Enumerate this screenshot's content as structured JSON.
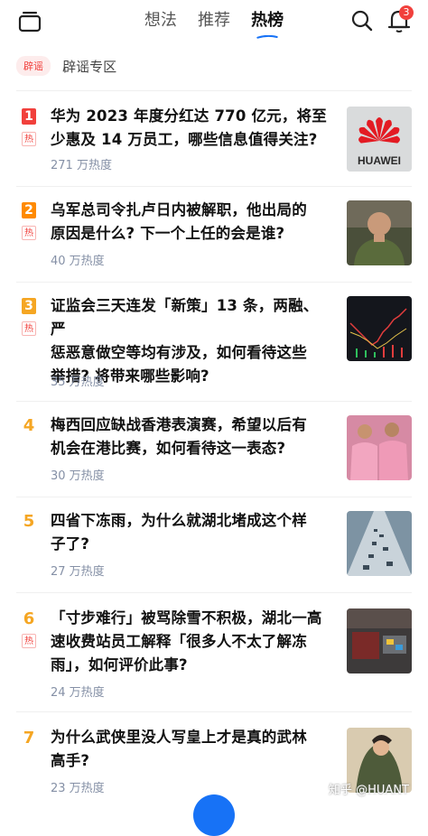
{
  "header": {
    "tabs": [
      {
        "label": "想法"
      },
      {
        "label": "推荐"
      },
      {
        "label": "热榜",
        "active": true
      }
    ],
    "notification_count": "3",
    "accent_color": "#1772f6"
  },
  "rumor": {
    "tag": "辟谣",
    "label": "辟谣专区"
  },
  "hot_tag": "热",
  "items": [
    {
      "rank": "1",
      "title_line1": "华为 2023 年度分红达 770 亿元，将至",
      "title_line2": "少惠及 14 万员工，哪些信息值得关注?",
      "title_line3": "",
      "heat": "271 万热度",
      "thumb_text": "HUAWEI"
    },
    {
      "rank": "2",
      "title_line1": "乌军总司令扎卢日内被解职，他出局的",
      "title_line2": "原因是什么? 下一个上任的会是谁?",
      "title_line3": "",
      "heat": "40 万热度"
    },
    {
      "rank": "3",
      "title_line1": "证监会三天连发「新策」13 条，两融、严",
      "title_line2": "惩恶意做空等均有涉及，如何看待这些",
      "title_line3": "举措? 将带来哪些影响?",
      "heat": "35 万热度"
    },
    {
      "rank": "4",
      "title_line1": "梅西回应缺战香港表演赛，希望以后有",
      "title_line2": "机会在港比赛，如何看待这一表态?",
      "title_line3": "",
      "heat": "30 万热度"
    },
    {
      "rank": "5",
      "title_line1": "四省下冻雨，为什么就湖北堵成这个样",
      "title_line2": "子了?",
      "title_line3": "",
      "heat": "27 万热度"
    },
    {
      "rank": "6",
      "title_line1": "「寸步难行」被骂除雪不积极，湖北一高",
      "title_line2": "速收费站员工解释「很多人不太了解冻",
      "title_line3": "雨」，如何评价此事?",
      "heat": "24 万热度"
    },
    {
      "rank": "7",
      "title_line1": "为什么武侠里没人写皇上才是真的武林",
      "title_line2": "高手?",
      "title_line3": "",
      "heat": "23 万热度"
    }
  ],
  "watermark": "知乎 @HUANT",
  "colors": {
    "rank1": "#f1403c",
    "rank2": "#ff8a00",
    "rank3": "#f5a623",
    "rank_other": "#f5a623",
    "hot": "#f1403c"
  }
}
